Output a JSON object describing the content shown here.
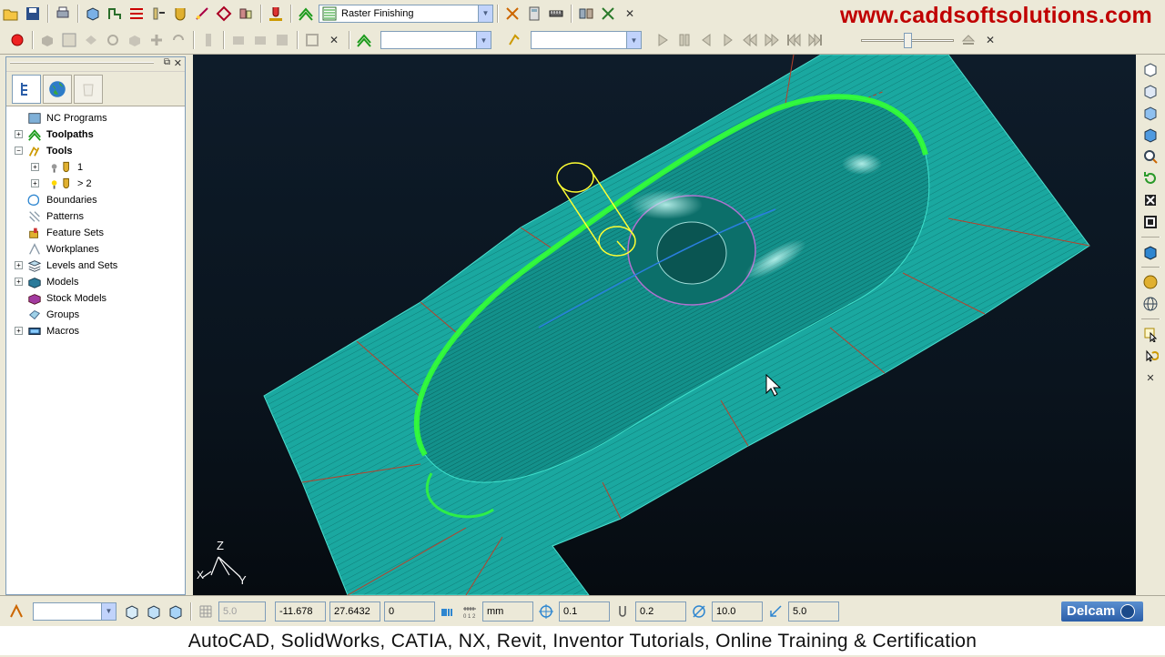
{
  "branding": {
    "website": "www.caddsoftsolutions.com",
    "caption": "AutoCAD, SolidWorks, CATIA, NX, Revit, Inventor Tutorials, Online Training & Certification",
    "logo": "Delcam"
  },
  "toolbar_top": {
    "strategy_select": "Raster Finishing",
    "icons": [
      "open-icon",
      "save-icon",
      "print-icon",
      "block-icon",
      "rapid-move-icon",
      "leads-icon",
      "feeds-icon",
      "tool-icon",
      "boundary-icon",
      "pattern-icon",
      "stock-icon",
      "simulate-icon",
      "toolpath-icon",
      "strategy-icon",
      "ncfile-icon",
      "calculator-icon",
      "measure-icon",
      "editor-icon",
      "close-icon"
    ]
  },
  "toolbar_sim": {
    "combo_1": "",
    "combo_2": ""
  },
  "explorer": {
    "items": [
      {
        "label": "NC Programs",
        "bold": false,
        "expander": "",
        "level": 0,
        "icon": "nc-programs-icon"
      },
      {
        "label": "Toolpaths",
        "bold": true,
        "expander": "+",
        "level": 0,
        "icon": "toolpaths-icon"
      },
      {
        "label": "Tools",
        "bold": true,
        "expander": "−",
        "level": 0,
        "icon": "tools-icon"
      },
      {
        "label": "1",
        "bold": false,
        "expander": "+",
        "level": 1,
        "icon": "tool-bulb-icon"
      },
      {
        "label": "> 2",
        "bold": false,
        "expander": "+",
        "level": 1,
        "icon": "tool-bulb-active-icon"
      },
      {
        "label": "Boundaries",
        "bold": false,
        "expander": "",
        "level": 0,
        "icon": "boundaries-icon"
      },
      {
        "label": "Patterns",
        "bold": false,
        "expander": "",
        "level": 0,
        "icon": "patterns-icon"
      },
      {
        "label": "Feature Sets",
        "bold": false,
        "expander": "",
        "level": 0,
        "icon": "feature-sets-icon"
      },
      {
        "label": "Workplanes",
        "bold": false,
        "expander": "",
        "level": 0,
        "icon": "workplanes-icon"
      },
      {
        "label": "Levels and Sets",
        "bold": false,
        "expander": "+",
        "level": 0,
        "icon": "levels-icon"
      },
      {
        "label": "Models",
        "bold": false,
        "expander": "+",
        "level": 0,
        "icon": "models-icon"
      },
      {
        "label": "Stock Models",
        "bold": false,
        "expander": "",
        "level": 0,
        "icon": "stock-models-icon"
      },
      {
        "label": "Groups",
        "bold": false,
        "expander": "",
        "level": 0,
        "icon": "groups-icon"
      },
      {
        "label": "Macros",
        "bold": false,
        "expander": "+",
        "level": 0,
        "icon": "macros-icon"
      }
    ]
  },
  "axes": {
    "z": "Z",
    "x": "X",
    "y": "Y"
  },
  "status": {
    "grid_value": "5.0",
    "x": "-11.678",
    "y": "27.6432",
    "z": "0",
    "units": "mm",
    "tolerance": "0.1",
    "thickness": "0.2",
    "diameter": "10.0",
    "step": "5.0"
  },
  "colors": {
    "background": "#ece9d8",
    "viewport": "#0e1c2a",
    "surface": "#1aa8a0",
    "toolpath": "#33ff33",
    "tool": "#ffff33",
    "brand": "#c00000"
  }
}
